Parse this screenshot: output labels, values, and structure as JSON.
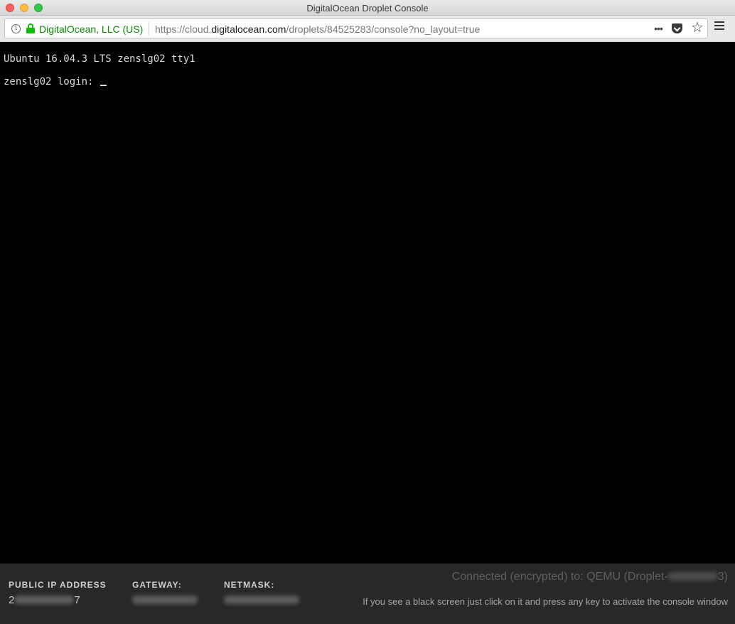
{
  "window": {
    "title": "DigitalOcean Droplet Console"
  },
  "urlbar": {
    "identity": "DigitalOcean, LLC (US)",
    "url_prefix": "https://cloud.",
    "url_domain": "digitalocean.com",
    "url_path": "/droplets/84525283/console?no_layout=true",
    "more_glyph": "•••",
    "star_glyph": "☆",
    "info_glyph": "i"
  },
  "console": {
    "line1": "Ubuntu 16.04.3 LTS zenslg02 tty1",
    "line2": "zenslg02 login: "
  },
  "footer": {
    "public_ip_label": "PUBLIC IP ADDRESS",
    "public_ip_start": "2",
    "public_ip_end": "7",
    "gateway_label": "GATEWAY:",
    "netmask_label": "NETMASK:",
    "status_prefix": "Connected (encrypted) to: QEMU (Droplet-",
    "status_suffix": "3)",
    "help_text": "If you see a black screen just click on it and press any key to activate the console window"
  },
  "icons": [
    "info-icon",
    "lock-icon",
    "more-icon",
    "pocket-icon",
    "star-icon",
    "menu-icon"
  ],
  "colors": {
    "identity_green": "#0a8a00",
    "lock_green": "#12bc00",
    "console_bg": "#000000",
    "footer_bg": "#282828"
  }
}
